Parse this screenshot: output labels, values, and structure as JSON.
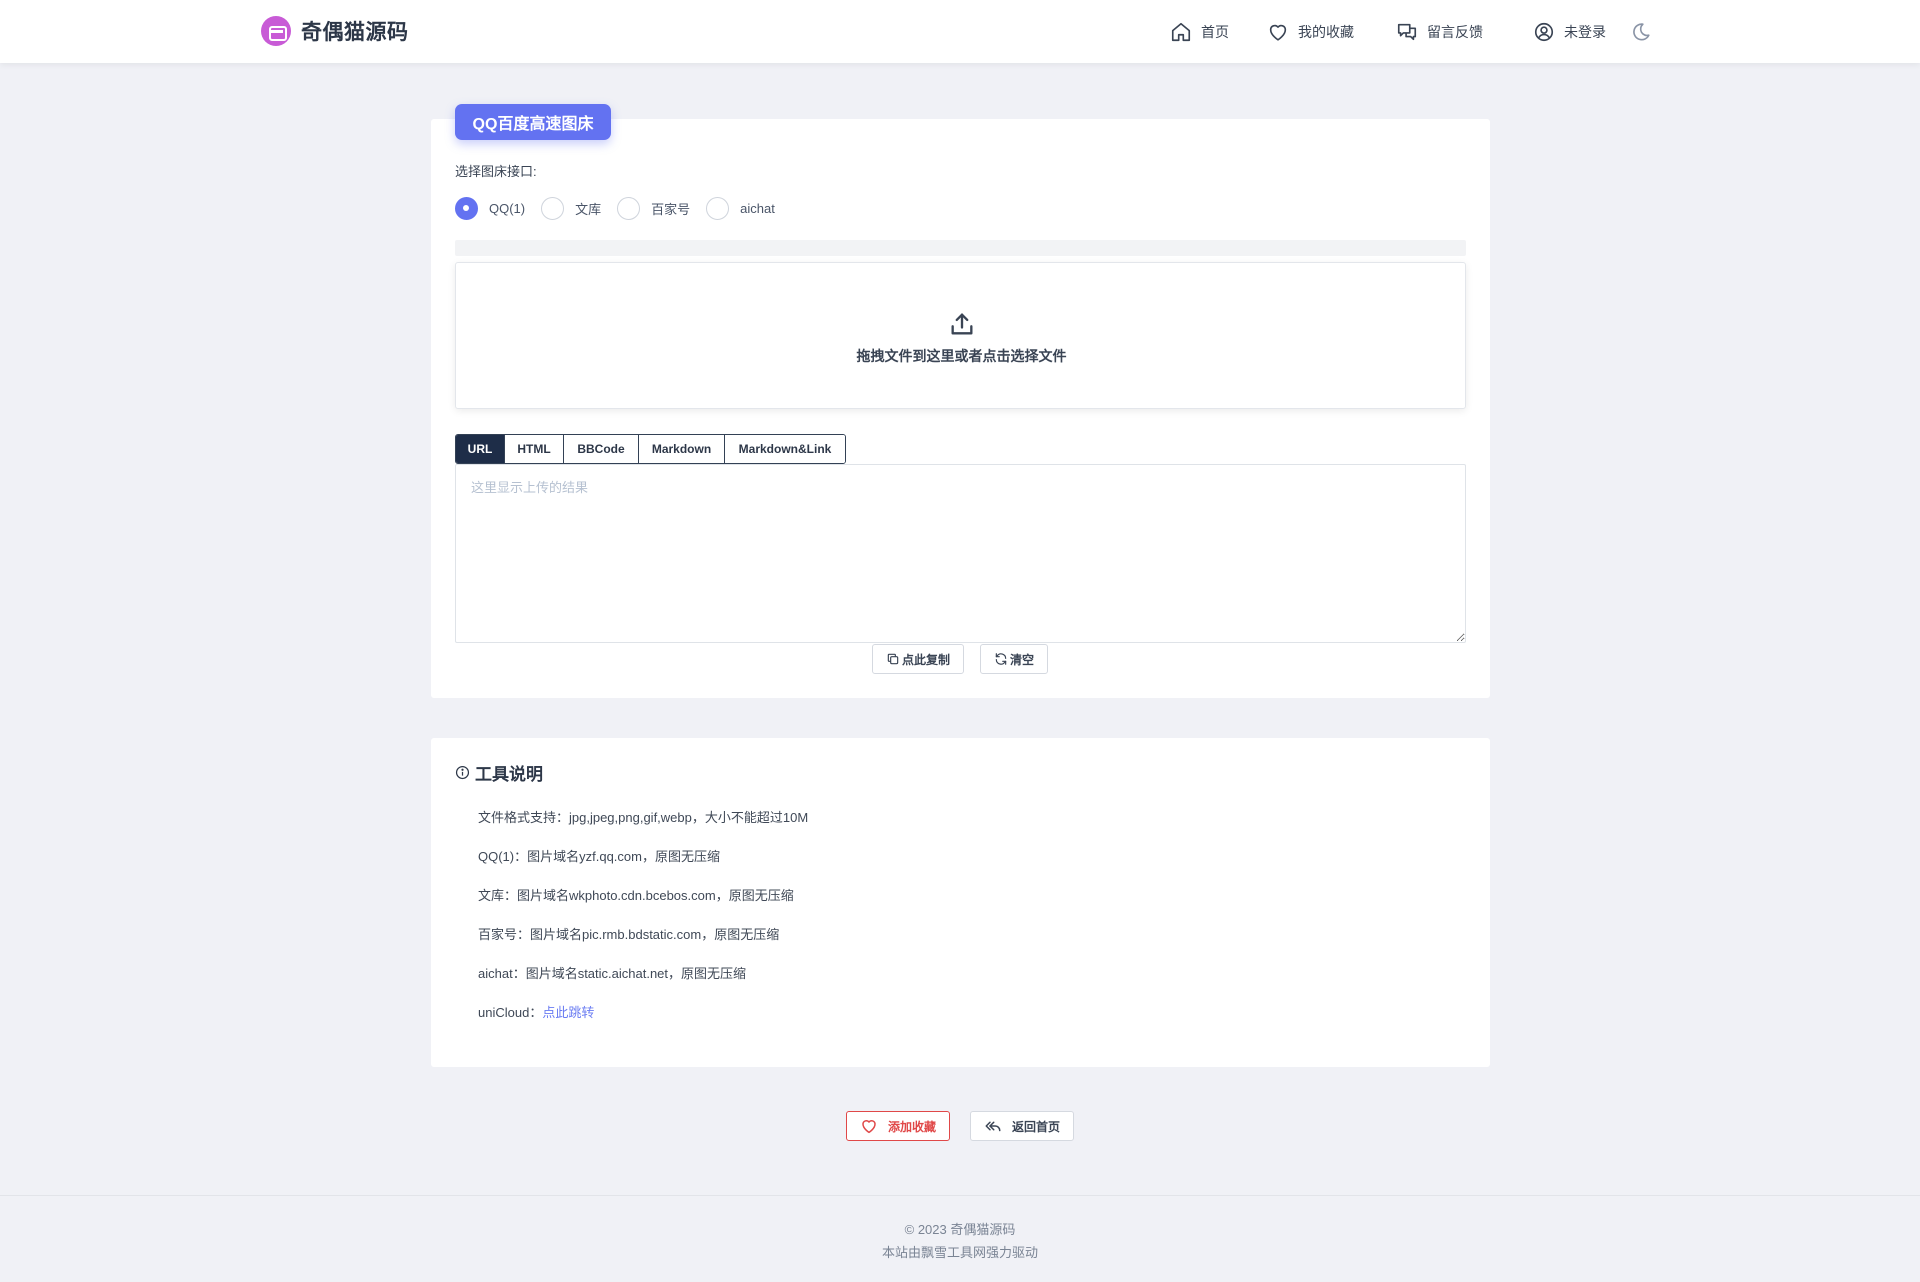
{
  "header": {
    "brand_name": "奇偶猫源码",
    "nav": {
      "home": "首页",
      "favorites": "我的收藏",
      "feedback": "留言反馈",
      "user": "未登录"
    }
  },
  "upload": {
    "title": "QQ百度高速图床",
    "api_label": "选择图床接口:",
    "options": [
      "QQ(1)",
      "文库",
      "百家号",
      "aichat"
    ],
    "selected_option": "QQ(1)",
    "dropzone_text": "拖拽文件到这里或者点击选择文件",
    "tabs": [
      "URL",
      "HTML",
      "BBCode",
      "Markdown",
      "Markdown&Link"
    ],
    "active_tab": "URL",
    "result_placeholder": "这里显示上传的结果",
    "copy_label": "点此复制",
    "clear_label": "清空"
  },
  "info": {
    "title": "工具说明",
    "lines": [
      "文件格式支持：jpg,jpeg,png,gif,webp，大小不能超过10M",
      "QQ(1)：图片域名yzf.qq.com，原图无压缩",
      "文库：图片域名wkphoto.cdn.bcebos.com，原图无压缩",
      "百家号：图片域名pic.rmb.bdstatic.com，原图无压缩",
      "aichat：图片域名static.aichat.net，原图无压缩"
    ],
    "unicloud_label": "uniCloud：",
    "unicloud_link": "点此跳转"
  },
  "actions": {
    "add_favorite": "添加收藏",
    "back_home": "返回首页"
  },
  "footer": {
    "copyright": "© 2023 奇偶猫源码",
    "powered": "本站由飘雪工具网强力驱动"
  },
  "colors": {
    "accent": "#6372f1",
    "tab_active": "#1e2d48",
    "danger": "#e04848",
    "link": "#6a7cf2",
    "brand_logo": "#c85bd6"
  }
}
